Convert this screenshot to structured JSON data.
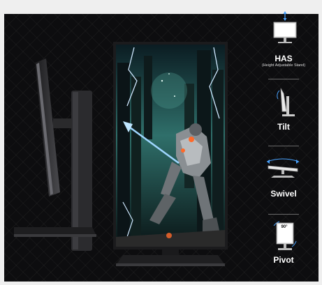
{
  "features": [
    {
      "label": "HAS",
      "sublabel": "(Height Adjustable Stand)",
      "icon": "height-adjust-icon"
    },
    {
      "label": "Tilt",
      "icon": "tilt-icon"
    },
    {
      "label": "Swivel",
      "icon": "swivel-icon"
    },
    {
      "label": "Pivot",
      "icon": "pivot-icon",
      "badge": "90°"
    }
  ],
  "colors": {
    "background": "#0d0d0f",
    "screen_sky": "#2f6f6a",
    "accent_glow": "#ff6a2a",
    "lightning": "#cfe8ff"
  }
}
